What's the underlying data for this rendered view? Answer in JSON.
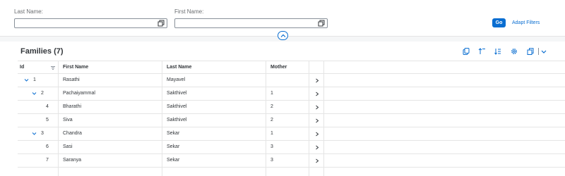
{
  "filters": {
    "last_name_label": "Last Name:",
    "last_name_value": "",
    "first_name_label": "First Name:",
    "first_name_value": "",
    "go_label": "Go",
    "adapt_label": "Adapt Filters"
  },
  "table": {
    "title": "Families (7)",
    "columns": [
      "Id",
      "First Name",
      "Last Name",
      "Mother"
    ],
    "rows": [
      {
        "id": "1",
        "first": "Rasathi",
        "last": "Mayavel",
        "mother": "",
        "level": 0,
        "expandable": true
      },
      {
        "id": "2",
        "first": "Pachaiyammal",
        "last": "Sakthivel",
        "mother": "1",
        "level": 1,
        "expandable": true
      },
      {
        "id": "4",
        "first": "Bharathi",
        "last": "Sakthivel",
        "mother": "2",
        "level": 2,
        "expandable": false
      },
      {
        "id": "5",
        "first": "Siva",
        "last": "Sakthivel",
        "mother": "2",
        "level": 2,
        "expandable": false
      },
      {
        "id": "3",
        "first": "Chandra",
        "last": "Sekar",
        "mother": "1",
        "level": 1,
        "expandable": true
      },
      {
        "id": "6",
        "first": "Sasi",
        "last": "Sekar",
        "mother": "3",
        "level": 2,
        "expandable": false
      },
      {
        "id": "7",
        "first": "Saranya",
        "last": "Sekar",
        "mother": "3",
        "level": 2,
        "expandable": false
      }
    ]
  },
  "colors": {
    "accent": "#0a6ed1",
    "text": "#32363a",
    "background": "#f5f6f7"
  },
  "icons": {
    "value_help": "value-help-icon",
    "collapse": "chevron-up-icon",
    "copy": "copy-icon",
    "sort_up": "sort-ascending-icon",
    "sort": "sort-icon",
    "settings": "gear-icon",
    "export": "export-icon",
    "menu": "chevron-down-icon",
    "expand": "expander-icon",
    "navigate": "chevron-right-icon"
  }
}
